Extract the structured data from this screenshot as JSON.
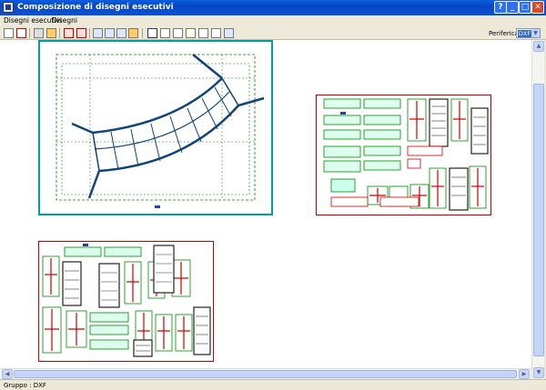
{
  "window": {
    "title": "Composizione di disegni esecutivi",
    "buttons": {
      "help": "?",
      "minimize": "_",
      "maximize": "□",
      "close": "✕"
    }
  },
  "menu": {
    "items": [
      "Disegni esecutivi",
      "Disegni"
    ]
  },
  "toolbar": {
    "periferica_label": "Periferica",
    "periferica_value": "DXF"
  },
  "drawings": [
    {
      "name": "arched-portal-layout"
    },
    {
      "name": "windows-doors-sheet-1"
    },
    {
      "name": "windows-doors-sheet-2"
    }
  ],
  "status": {
    "text": "Gruppo : DXF"
  },
  "colors": {
    "titlebar": "#0a53d8",
    "sheet1_border": "#00a0a0",
    "sheet_border": "#c00000",
    "frames": "#008000",
    "mullions": "#c00000"
  }
}
